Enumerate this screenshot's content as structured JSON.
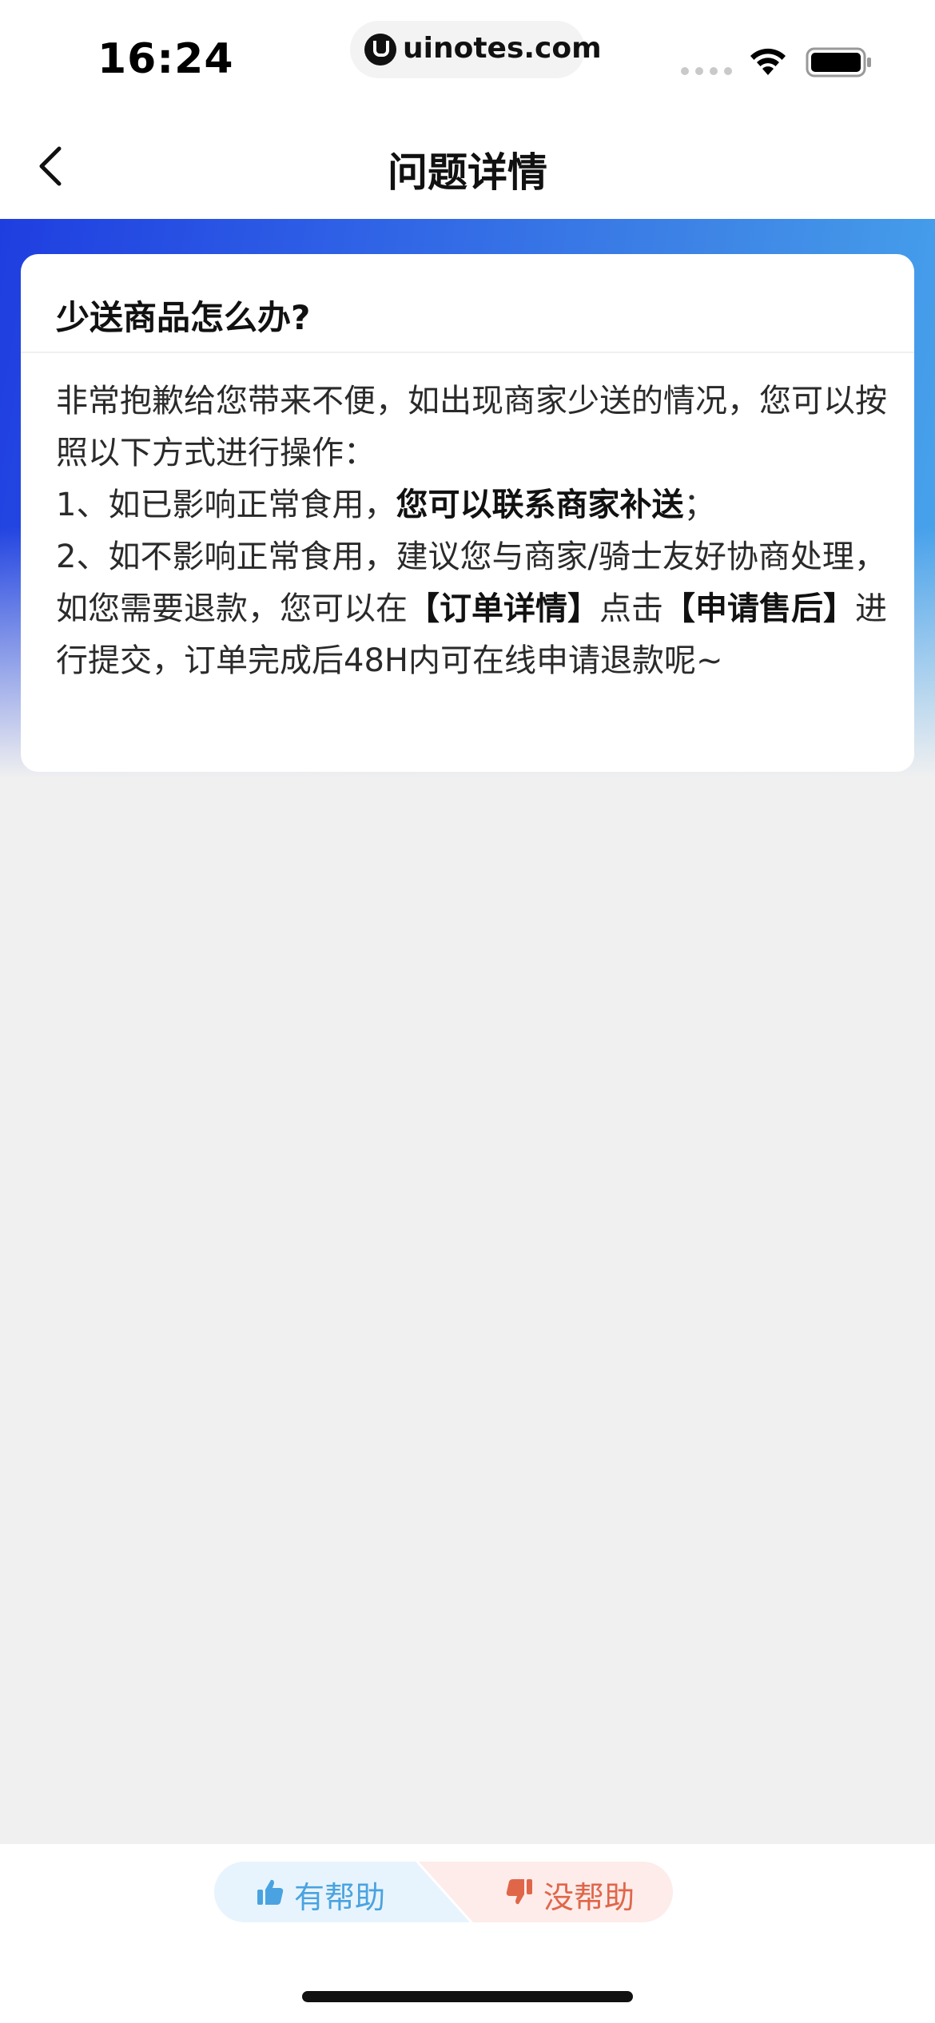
{
  "status_bar": {
    "time": "16:24",
    "url": "uinotes.com"
  },
  "nav": {
    "title": "问题详情"
  },
  "card": {
    "question": "少送商品怎么办?",
    "line1": "非常抱歉给您带来不便，如出现商家少送的情况，您可以按照以下方式进行操作：",
    "line2_prefix": "1、如已影响正常食用，",
    "line2_bold": "您可以联系商家补送",
    "line2_suffix": "；",
    "line3_prefix": "2、如不影响正常食用，建议您与商家/骑士友好协商处理，如您需要退款，您可以在",
    "line3_bold1": "【订单详情】",
    "line3_mid": "点击",
    "line3_bold2": "【申请售后】",
    "line3_suffix": "进行提交，订单完成后48H内可在线申请退款呢~"
  },
  "feedback": {
    "helpful_label": "有帮助",
    "not_helpful_label": "没帮助",
    "helpful_color": "#4aa3e0",
    "not_helpful_color": "#e0664a"
  },
  "colors": {
    "gradient_start": "#1f3ee0",
    "gradient_end": "#48a6ec",
    "page_background": "#f0f0f0"
  }
}
